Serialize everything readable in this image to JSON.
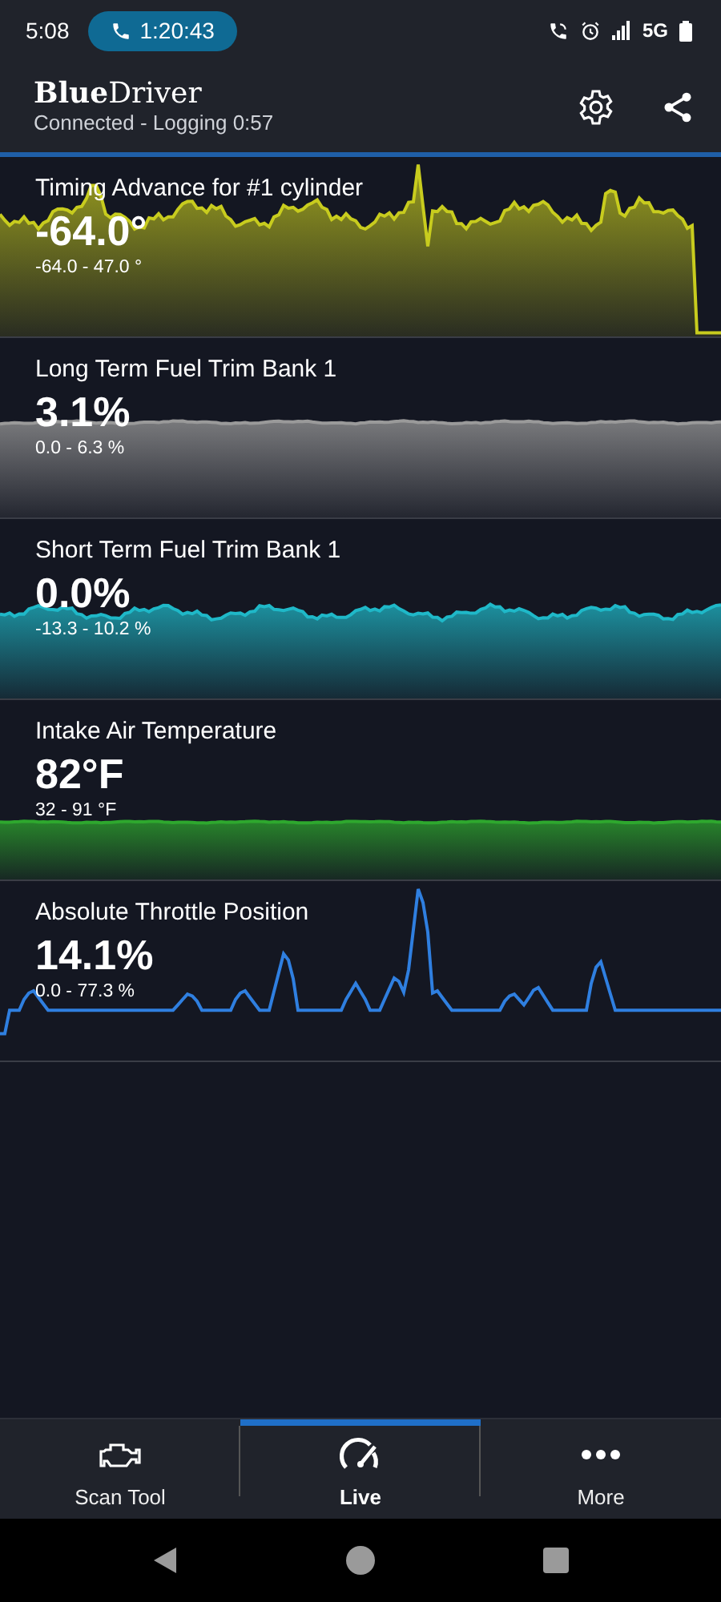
{
  "status_bar": {
    "time": "5:08",
    "call_timer": "1:20:43",
    "network": "5G"
  },
  "app_bar": {
    "title": "**Blue**Driver",
    "subtitle": "Connected - Logging 0:57"
  },
  "sensors": [
    {
      "name": "Timing Advance for #1 cylinder",
      "value": "-64.0°",
      "range": "-64.0 - 47.0 °",
      "color": "#c8cc1e",
      "fill": true
    },
    {
      "name": "Long Term Fuel Trim Bank 1",
      "value": "3.1%",
      "range": "0.0 - 6.3 %",
      "color": "#9a9a9a",
      "fill": true
    },
    {
      "name": "Short Term Fuel Trim Bank 1",
      "value": "0.0%",
      "range": "-13.3 - 10.2 %",
      "color": "#1fb8c8",
      "fill": true
    },
    {
      "name": "Intake Air Temperature",
      "value": "82°F",
      "range": "32 - 91 °F",
      "color": "#2ea82e",
      "fill": true
    },
    {
      "name": "Absolute Throttle Position",
      "value": "14.1%",
      "range": "0.0 - 77.3 %",
      "color": "#2f7fe0",
      "fill": false
    }
  ],
  "nav": [
    {
      "label": "Scan Tool",
      "kind": "engine",
      "selected": false
    },
    {
      "label": "Live",
      "kind": "gauge",
      "selected": true
    },
    {
      "label": "More",
      "kind": "dots",
      "selected": false
    }
  ]
}
